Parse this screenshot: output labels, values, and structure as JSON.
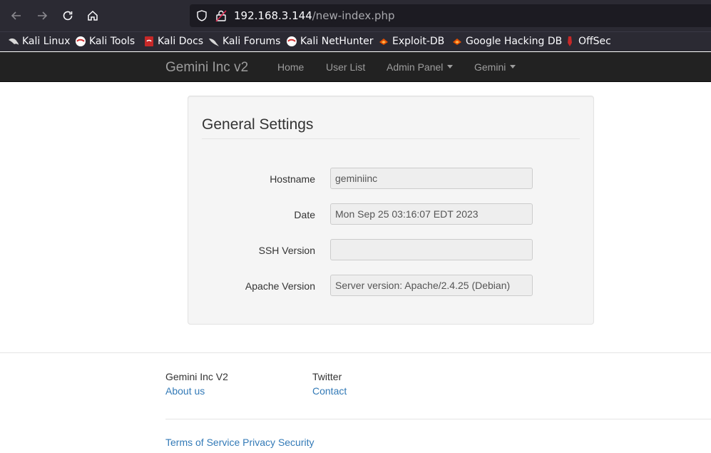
{
  "browser": {
    "url_host": "192.168.3.144",
    "url_path": "/new-index.php",
    "bookmarks": [
      {
        "label": "Kali Linux",
        "icon": "kali-dragon-icon"
      },
      {
        "label": "Kali Tools",
        "icon": "kali-tools-icon"
      },
      {
        "label": "Kali Docs",
        "icon": "kali-docs-icon"
      },
      {
        "label": "Kali Forums",
        "icon": "kali-forums-icon"
      },
      {
        "label": "Kali NetHunter",
        "icon": "kali-nethunter-icon"
      },
      {
        "label": "Exploit-DB",
        "icon": "exploit-db-icon"
      },
      {
        "label": "Google Hacking DB",
        "icon": "ghdb-icon"
      },
      {
        "label": "OffSec",
        "icon": "offsec-icon"
      }
    ]
  },
  "navbar": {
    "brand": "Gemini Inc v2",
    "links": [
      "Home",
      "User List",
      "Admin Panel",
      "Gemini"
    ]
  },
  "settings": {
    "title": "General Settings",
    "fields": [
      {
        "label": "Hostname",
        "value": "geminiinc"
      },
      {
        "label": "Date",
        "value": "Mon Sep 25 03:16:07 EDT 2023"
      },
      {
        "label": "SSH Version",
        "value": ""
      },
      {
        "label": "Apache Version",
        "value": "Server version: Apache/2.4.25 (Debian)"
      }
    ]
  },
  "footer": {
    "col1_title": "Gemini Inc V2",
    "col1_link": "About us",
    "col2_title": "Twitter",
    "col2_link": "Contact",
    "bottom_links": [
      "Terms of Service",
      "Privacy",
      "Security"
    ]
  },
  "colors": {
    "browser_bg": "#2b2a33",
    "navbar_bg": "#222222",
    "link": "#337ab7"
  }
}
